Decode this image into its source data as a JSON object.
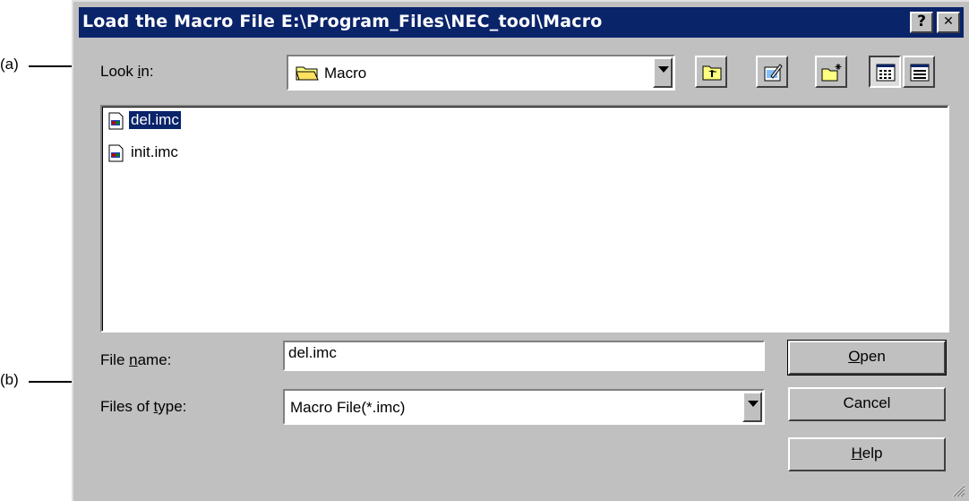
{
  "annotations": {
    "a": "(a)",
    "b": "(b)"
  },
  "window": {
    "title": "Load the Macro File E:\\Program_Files\\NEC_tool\\Macro",
    "help_btn": "?",
    "close_btn": "✕"
  },
  "look_in": {
    "label_pre": "Look ",
    "label_key": "i",
    "label_post": "n:",
    "value": "Macro"
  },
  "toolbar": {
    "icons": [
      "up-one-level-icon",
      "desktop-icon",
      "new-folder-icon",
      "list-view-icon",
      "details-view-icon"
    ]
  },
  "files": [
    {
      "name": "del.imc",
      "selected": true
    },
    {
      "name": "init.imc",
      "selected": false
    }
  ],
  "file_name": {
    "label_pre": "File ",
    "label_key": "n",
    "label_post": "ame:",
    "value": "del.imc"
  },
  "file_type": {
    "label_pre": "Files of ",
    "label_key": "t",
    "label_post": "ype:",
    "value": "Macro File(*.imc)"
  },
  "buttons": {
    "open_key": "O",
    "open_rest": "pen",
    "cancel": "Cancel",
    "help_key": "H",
    "help_rest": "elp"
  },
  "colors": {
    "titlebar": "#0a246a",
    "face": "#c0c0c0",
    "selection": "#0a246a"
  }
}
